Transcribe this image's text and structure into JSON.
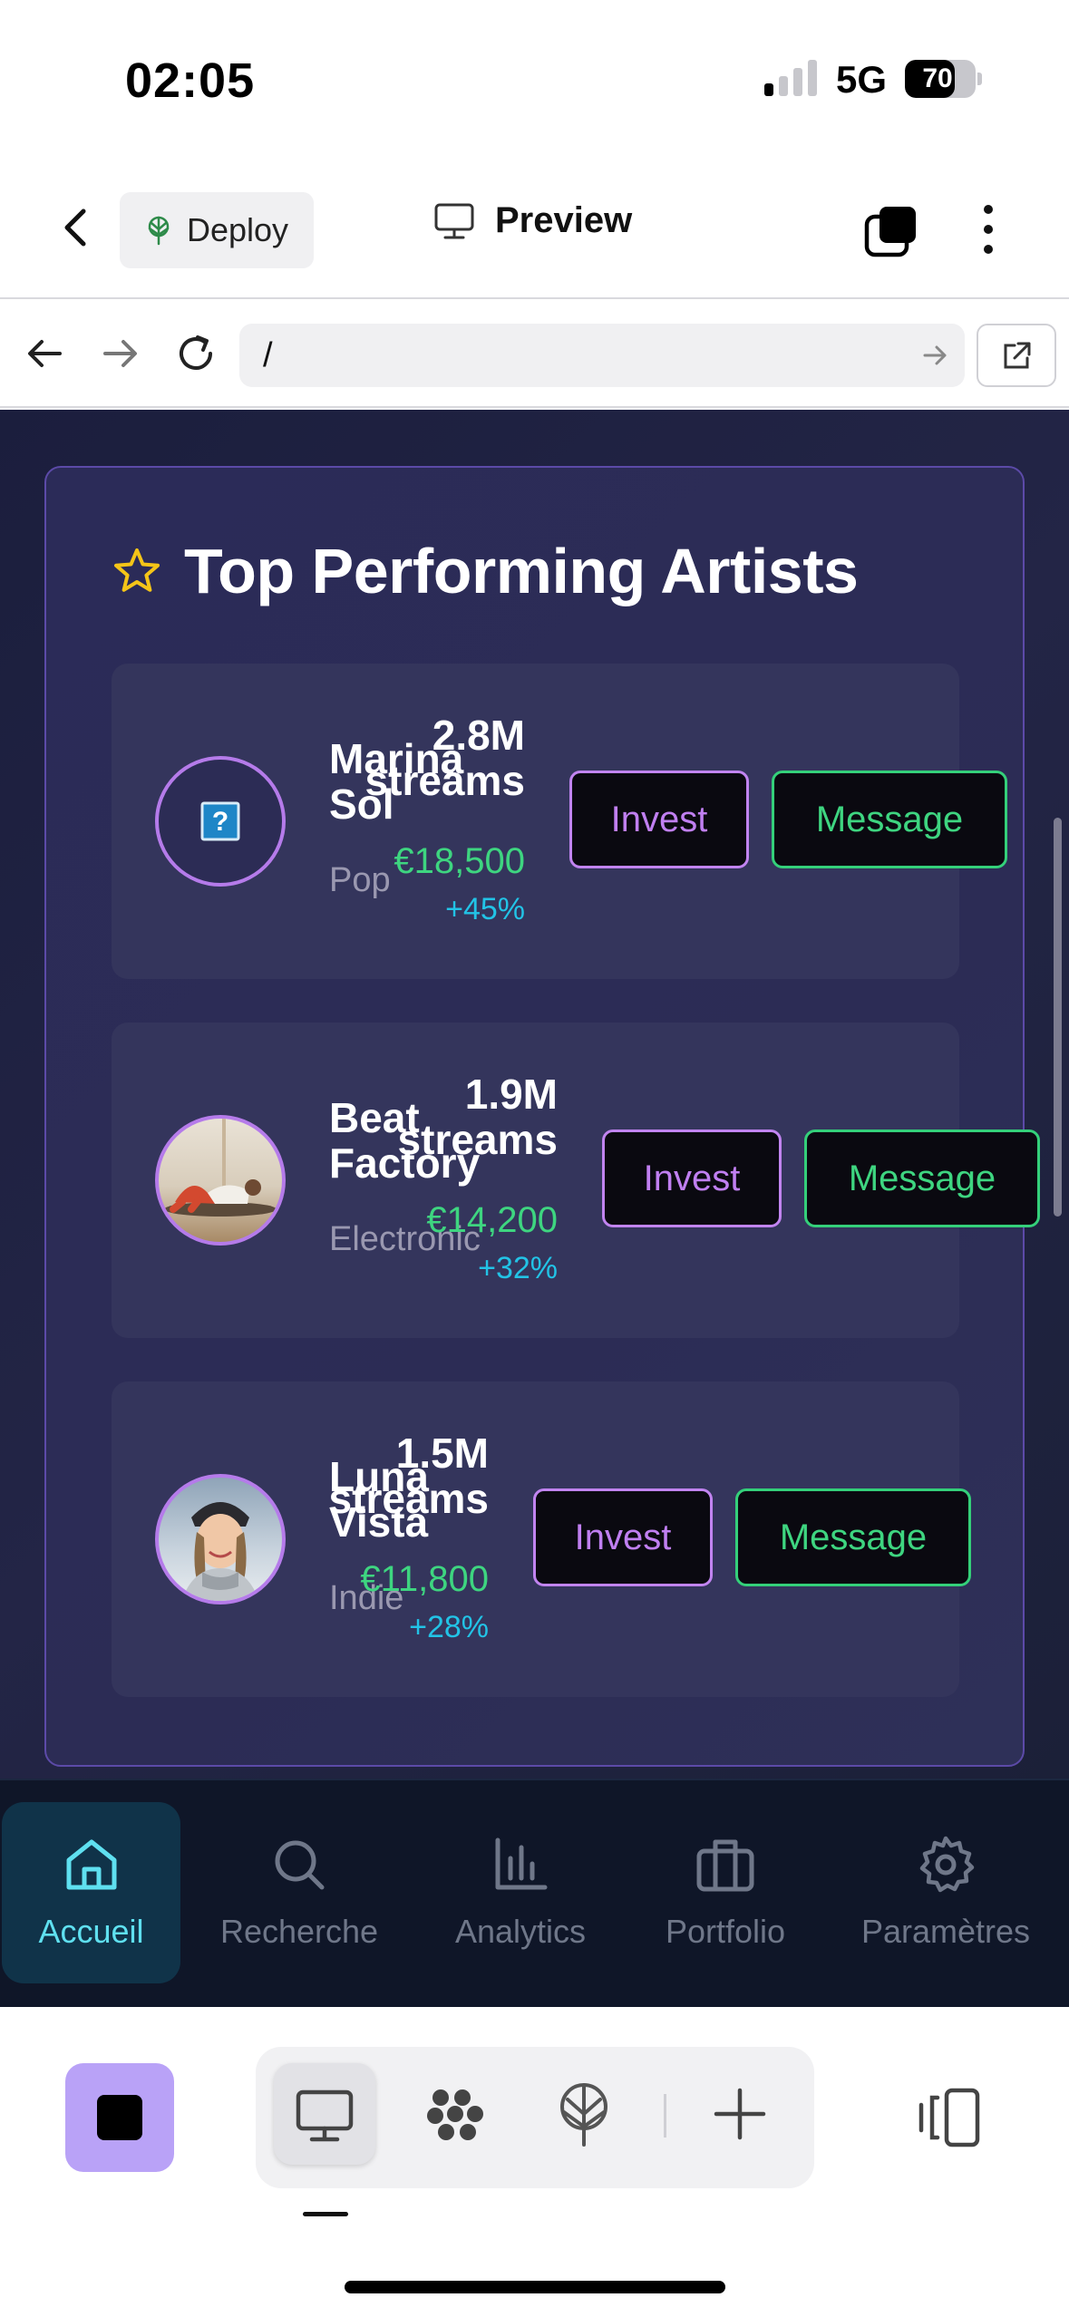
{
  "status_bar": {
    "time": "02:05",
    "network": "5G",
    "battery": "70",
    "battery_level": 0.7
  },
  "toolbar": {
    "deploy_label": "Deploy",
    "preview_label": "Preview"
  },
  "browser": {
    "url": "/"
  },
  "section": {
    "title": "Top Performing Artists",
    "icon": "star-icon"
  },
  "artists": [
    {
      "name": "Marina Sol",
      "genre": "Pop",
      "streams": "2.8M streams",
      "amount": "€18,500",
      "growth": "+45%",
      "invest_label": "Invest",
      "message_label": "Message",
      "avatar": "broken-image-icon"
    },
    {
      "name": "Beat Factory",
      "genre": "Electronic",
      "streams": "1.9M streams",
      "amount": "€14,200",
      "growth": "+32%",
      "invest_label": "Invest",
      "message_label": "Message",
      "avatar": "photo"
    },
    {
      "name": "Luna Vista",
      "genre": "Indie",
      "streams": "1.5M streams",
      "amount": "€11,800",
      "growth": "+28%",
      "invest_label": "Invest",
      "message_label": "Message",
      "avatar": "photo"
    }
  ],
  "bottom_nav": [
    {
      "label": "Accueil",
      "icon": "home-icon",
      "active": true
    },
    {
      "label": "Recherche",
      "icon": "search-icon",
      "active": false
    },
    {
      "label": "Analytics",
      "icon": "bar-chart-icon",
      "active": false
    },
    {
      "label": "Portfolio",
      "icon": "briefcase-icon",
      "active": false
    },
    {
      "label": "Paramètres",
      "icon": "gear-icon",
      "active": false
    }
  ],
  "colors": {
    "accent_purple": "#c07ff1",
    "accent_green": "#3ed580",
    "accent_cyan": "#22c3e6",
    "star": "#f5c518",
    "nav_active": "#5fe0f0"
  }
}
